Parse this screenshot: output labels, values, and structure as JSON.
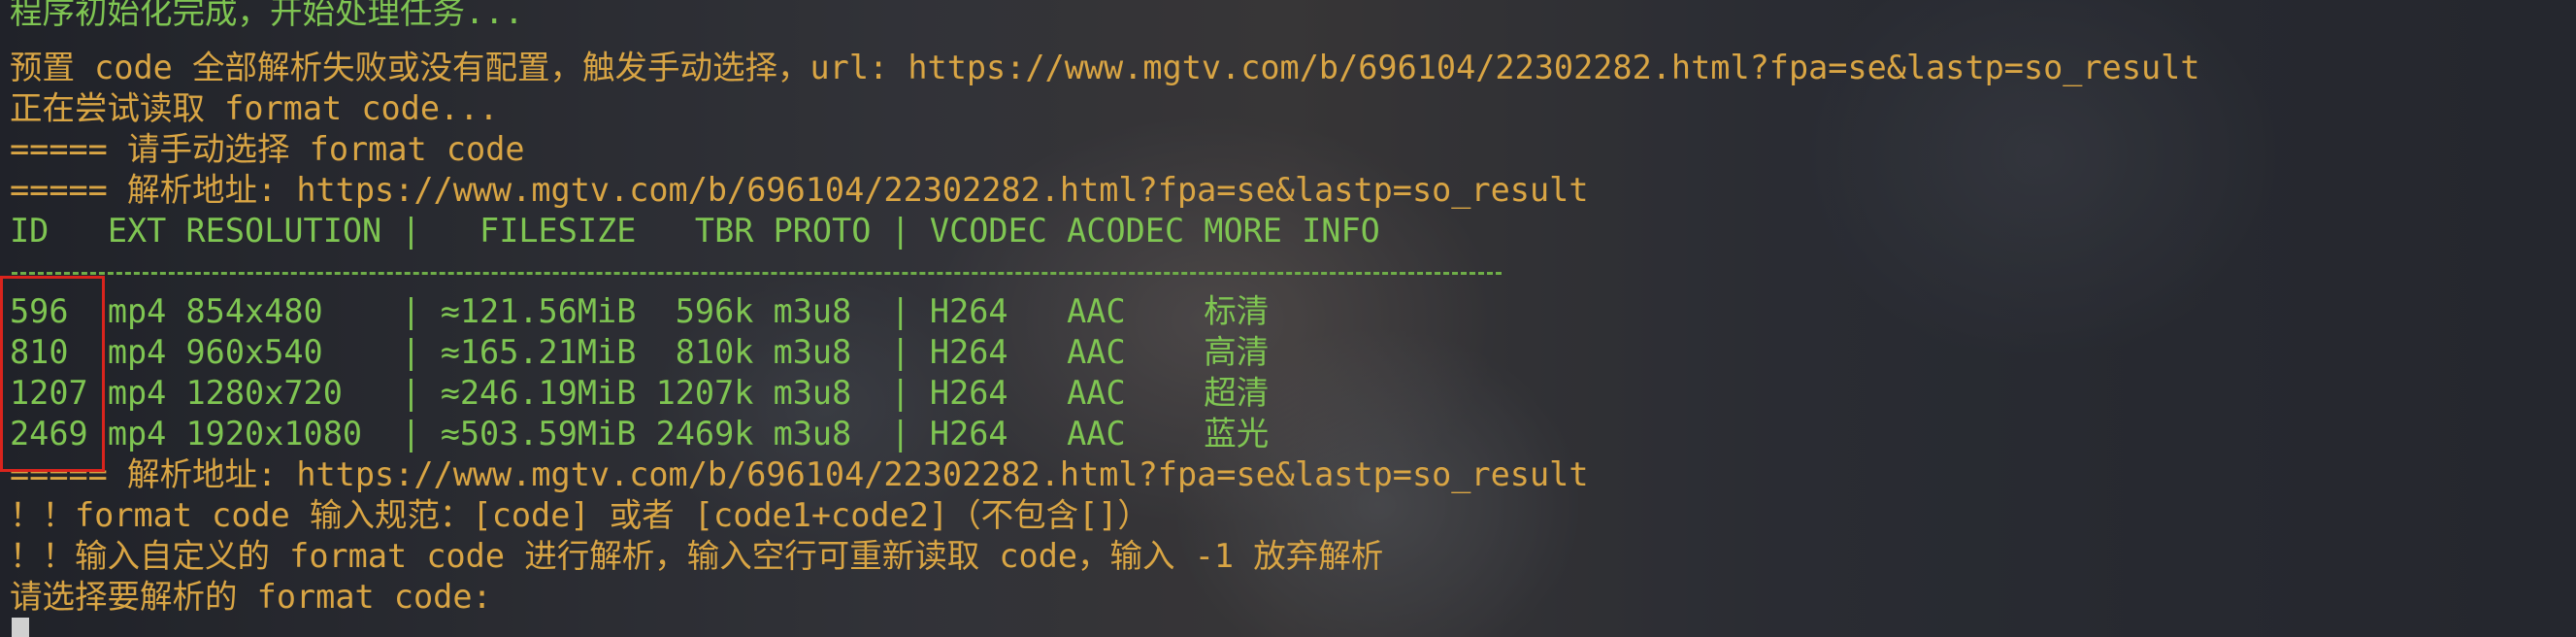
{
  "terminal": {
    "lines": {
      "l0": "程序初始化完成，开始处理任务...",
      "l1": "预置 code 全部解析失败或没有配置，触发手动选择，url: https://www.mgtv.com/b/696104/22302282.html?fpa=se&lastp=so_result",
      "l2": "正在尝试读取 format code...",
      "l3": "===== 请手动选择 format code",
      "l4": "===== 解析地址: https://www.mgtv.com/b/696104/22302282.html?fpa=se&lastp=so_result",
      "header": "ID   EXT RESOLUTION |   FILESIZE   TBR PROTO | VCODEC ACODEC MORE INFO",
      "r1": "596  mp4 854x480    | ≈121.56MiB  596k m3u8  | H264   AAC    标清",
      "r2": "810  mp4 960x540    | ≈165.21MiB  810k m3u8  | H264   AAC    高清",
      "r3": "1207 mp4 1280x720   | ≈246.19MiB 1207k m3u8  | H264   AAC    超清",
      "r4": "2469 mp4 1920x1080  | ≈503.59MiB 2469k m3u8  | H264   AAC    蓝光",
      "l5": "===== 解析地址: https://www.mgtv.com/b/696104/22302282.html?fpa=se&lastp=so_result",
      "l6": "！！format code 输入规范：[code] 或者 [code1+code2]（不包含[]）",
      "l7": "！！输入自定义的 format code 进行解析，输入空行可重新读取 code，输入 -1 放弃解析",
      "l8": "请选择要解析的 format code:"
    }
  },
  "colors": {
    "text_yellow": "#d9a544",
    "text_green": "#7fc552",
    "highlight_red": "#d9241d"
  }
}
